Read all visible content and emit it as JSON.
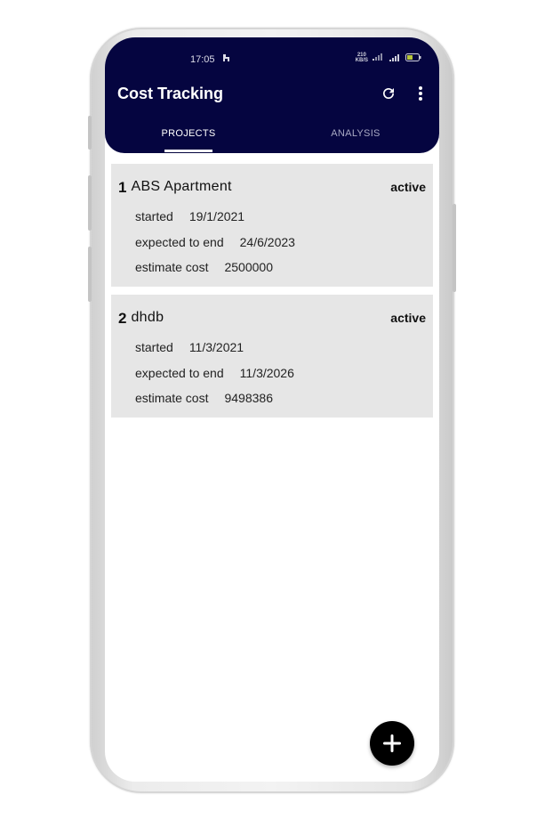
{
  "status_bar": {
    "time": "17:05",
    "net_speed": "210 KB/S",
    "battery": "41",
    "icons": [
      "app-notification-icon",
      "signal-icon",
      "signal-4g-icon",
      "battery-icon"
    ]
  },
  "app_bar": {
    "title": "Cost Tracking",
    "icons": [
      "refresh-icon",
      "more-vert-icon"
    ]
  },
  "tabs": [
    {
      "label": "PROJECTS",
      "selected": true
    },
    {
      "label": "ANALYSIS",
      "selected": false
    }
  ],
  "projects": [
    {
      "number": "1",
      "name": "ABS Apartment",
      "status": "active",
      "started_label": "started",
      "started": "19/1/2021",
      "end_label": "expected to end",
      "end": "24/6/2023",
      "cost_label": "estimate cost",
      "cost": "2500000"
    },
    {
      "number": "2",
      "name": "dhdb",
      "status": "active",
      "started_label": "started",
      "started": "11/3/2021",
      "end_label": "expected to end",
      "end": "11/3/2026",
      "cost_label": "estimate cost",
      "cost": "9498386"
    }
  ],
  "fab": {
    "icon": "plus-icon"
  },
  "colors": {
    "app_bar": "#050540",
    "card": "#e6e6e6",
    "fab": "#000000"
  }
}
